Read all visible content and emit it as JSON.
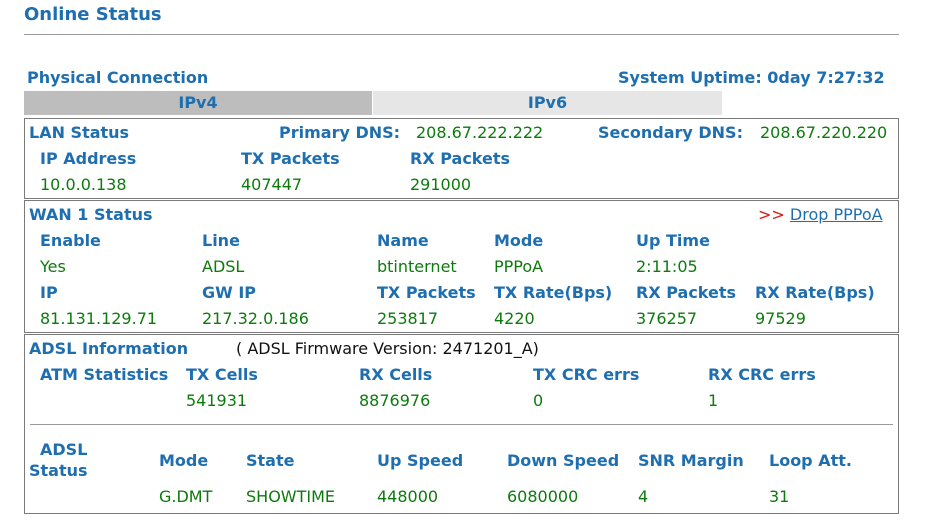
{
  "page": {
    "title": "Online Status"
  },
  "header": {
    "section": "Physical Connection",
    "uptime_label": "System Uptime:",
    "uptime_value": "0day 7:27:32"
  },
  "tabs": [
    {
      "label": "IPv4"
    },
    {
      "label": "IPv6"
    }
  ],
  "lan": {
    "title": "LAN Status",
    "primary_dns_label": "Primary DNS:",
    "primary_dns": "208.67.222.222",
    "secondary_dns_label": "Secondary DNS:",
    "secondary_dns": "208.67.220.220",
    "headers": [
      "IP Address",
      "TX Packets",
      "RX Packets"
    ],
    "values": [
      "10.0.0.138",
      "407447",
      "291000"
    ]
  },
  "wan": {
    "title": "WAN 1 Status",
    "drop_arrows": ">>",
    "drop_label": "Drop PPPoA",
    "row1_headers": [
      "Enable",
      "Line",
      "Name",
      "Mode",
      "Up Time"
    ],
    "row1_values": [
      "Yes",
      "ADSL",
      "btinternet",
      "PPPoA",
      "2:11:05"
    ],
    "row2_headers": [
      "IP",
      "GW IP",
      "TX Packets",
      "TX Rate(Bps)",
      "RX Packets",
      "RX Rate(Bps)"
    ],
    "row2_values": [
      "81.131.129.71",
      "217.32.0.186",
      "253817",
      "4220",
      "376257",
      "97529"
    ]
  },
  "adsl": {
    "title": "ADSL Information",
    "firmware": "( ADSL Firmware Version:  2471201_A)",
    "atm_label": "ATM Statistics",
    "atm_headers": [
      "TX Cells",
      "RX Cells",
      "TX CRC errs",
      "RX CRC errs"
    ],
    "atm_values": [
      "541931",
      "8876976",
      "0",
      "1"
    ],
    "status_label_1": "ADSL",
    "status_label_2": "Status",
    "status_headers": [
      "Mode",
      "State",
      "Up Speed",
      "Down Speed",
      "SNR Margin",
      "Loop Att."
    ],
    "status_values": [
      "G.DMT",
      "SHOWTIME",
      "448000",
      "6080000",
      "4",
      "31"
    ]
  }
}
